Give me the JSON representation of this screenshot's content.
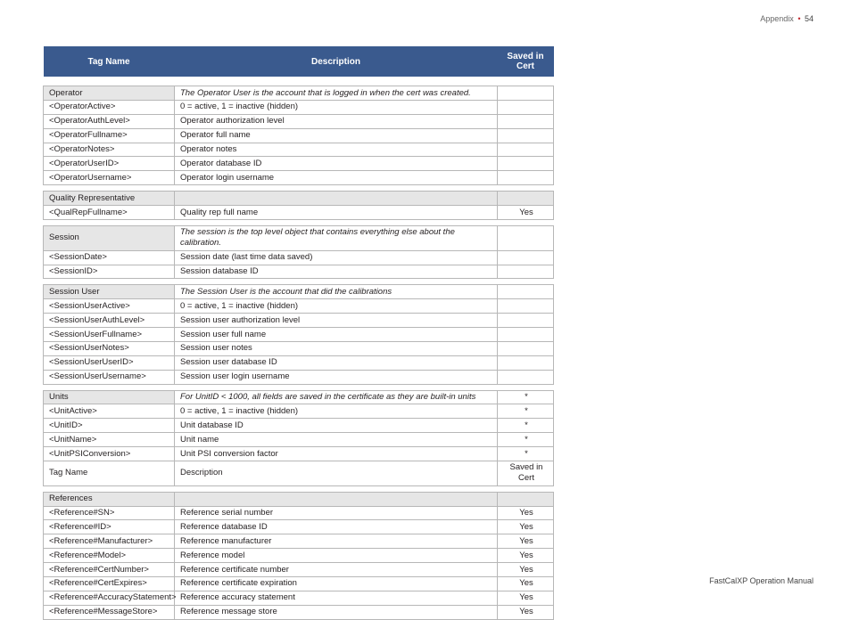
{
  "header": {
    "section": "Appendix",
    "page_number": "54"
  },
  "footer": {
    "text": "FastCalXP Operation Manual"
  },
  "columns": {
    "tag": "Tag Name",
    "desc": "Description",
    "cert": "Saved in Cert"
  },
  "groups": [
    {
      "section": {
        "label": "Operator",
        "desc": "The Operator User is the account that is logged in when the cert was created.",
        "cert": ""
      },
      "rows": [
        {
          "tag": "<OperatorActive>",
          "desc": "0 = active, 1 = inactive (hidden)",
          "cert": ""
        },
        {
          "tag": "<OperatorAuthLevel>",
          "desc": "Operator authorization level",
          "cert": ""
        },
        {
          "tag": "<OperatorFullname>",
          "desc": "Operator full name",
          "cert": ""
        },
        {
          "tag": "<OperatorNotes>",
          "desc": "Operator notes",
          "cert": ""
        },
        {
          "tag": "<OperatorUserID>",
          "desc": "Operator database ID",
          "cert": ""
        },
        {
          "tag": "<OperatorUsername>",
          "desc": "Operator login username",
          "cert": ""
        }
      ]
    },
    {
      "section": {
        "label": "Quality Representative",
        "desc": "",
        "cert": ""
      },
      "rows": [
        {
          "tag": "<QualRepFullname>",
          "desc": "Quality rep full name",
          "cert": "Yes"
        }
      ]
    },
    {
      "section": {
        "label": "Session",
        "desc": "The session is the top level object that contains everything else about the calibration.",
        "cert": ""
      },
      "rows": [
        {
          "tag": "<SessionDate>",
          "desc": "Session date (last time data saved)",
          "cert": ""
        },
        {
          "tag": "<SessionID>",
          "desc": "Session database ID",
          "cert": ""
        }
      ]
    },
    {
      "section": {
        "label": "Session User",
        "desc": "The Session User is the account that did the calibrations",
        "cert": ""
      },
      "rows": [
        {
          "tag": "<SessionUserActive>",
          "desc": "0 = active, 1 = inactive (hidden)",
          "cert": ""
        },
        {
          "tag": "<SessionUserAuthLevel>",
          "desc": "Session user authorization level",
          "cert": ""
        },
        {
          "tag": "<SessionUserFullname>",
          "desc": "Session user full name",
          "cert": ""
        },
        {
          "tag": "<SessionUserNotes>",
          "desc": "Session user notes",
          "cert": ""
        },
        {
          "tag": "<SessionUserUserID>",
          "desc": "Session user database ID",
          "cert": ""
        },
        {
          "tag": "<SessionUserUsername>",
          "desc": "Session user login username",
          "cert": ""
        }
      ]
    },
    {
      "section": {
        "label": "Units",
        "desc": "For UnitID < 1000, all fields are saved in the certificate as they are built-in units",
        "cert": "*"
      },
      "rows": [
        {
          "tag": "<UnitActive>",
          "desc": "0 = active, 1 = inactive (hidden)",
          "cert": "*"
        },
        {
          "tag": "<UnitID>",
          "desc": "Unit database ID",
          "cert": "*"
        },
        {
          "tag": "<UnitName>",
          "desc": "Unit name",
          "cert": "*"
        },
        {
          "tag": "<UnitPSIConversion>",
          "desc": "Unit PSI conversion factor",
          "cert": "*"
        },
        {
          "tag": "Tag Name",
          "desc": "Description",
          "cert": "Saved in Cert"
        }
      ]
    },
    {
      "section": {
        "label": "References",
        "desc": "",
        "cert": ""
      },
      "rows": [
        {
          "tag": "<Reference#SN>",
          "desc": "Reference serial number",
          "cert": "Yes"
        },
        {
          "tag": "<Reference#ID>",
          "desc": "Reference database ID",
          "cert": "Yes"
        },
        {
          "tag": "<Reference#Manufacturer>",
          "desc": "Reference manufacturer",
          "cert": "Yes"
        },
        {
          "tag": "<Reference#Model>",
          "desc": "Reference model",
          "cert": "Yes"
        },
        {
          "tag": "<Reference#CertNumber>",
          "desc": "Reference certificate number",
          "cert": "Yes"
        },
        {
          "tag": "<Reference#CertExpires>",
          "desc": "Reference certificate expiration",
          "cert": "Yes"
        },
        {
          "tag": "<Reference#AccuracyStatement>",
          "desc": "Reference accuracy statement",
          "cert": "Yes"
        },
        {
          "tag": "<Reference#MessageStore>",
          "desc": "Reference message store",
          "cert": "Yes"
        }
      ]
    }
  ]
}
